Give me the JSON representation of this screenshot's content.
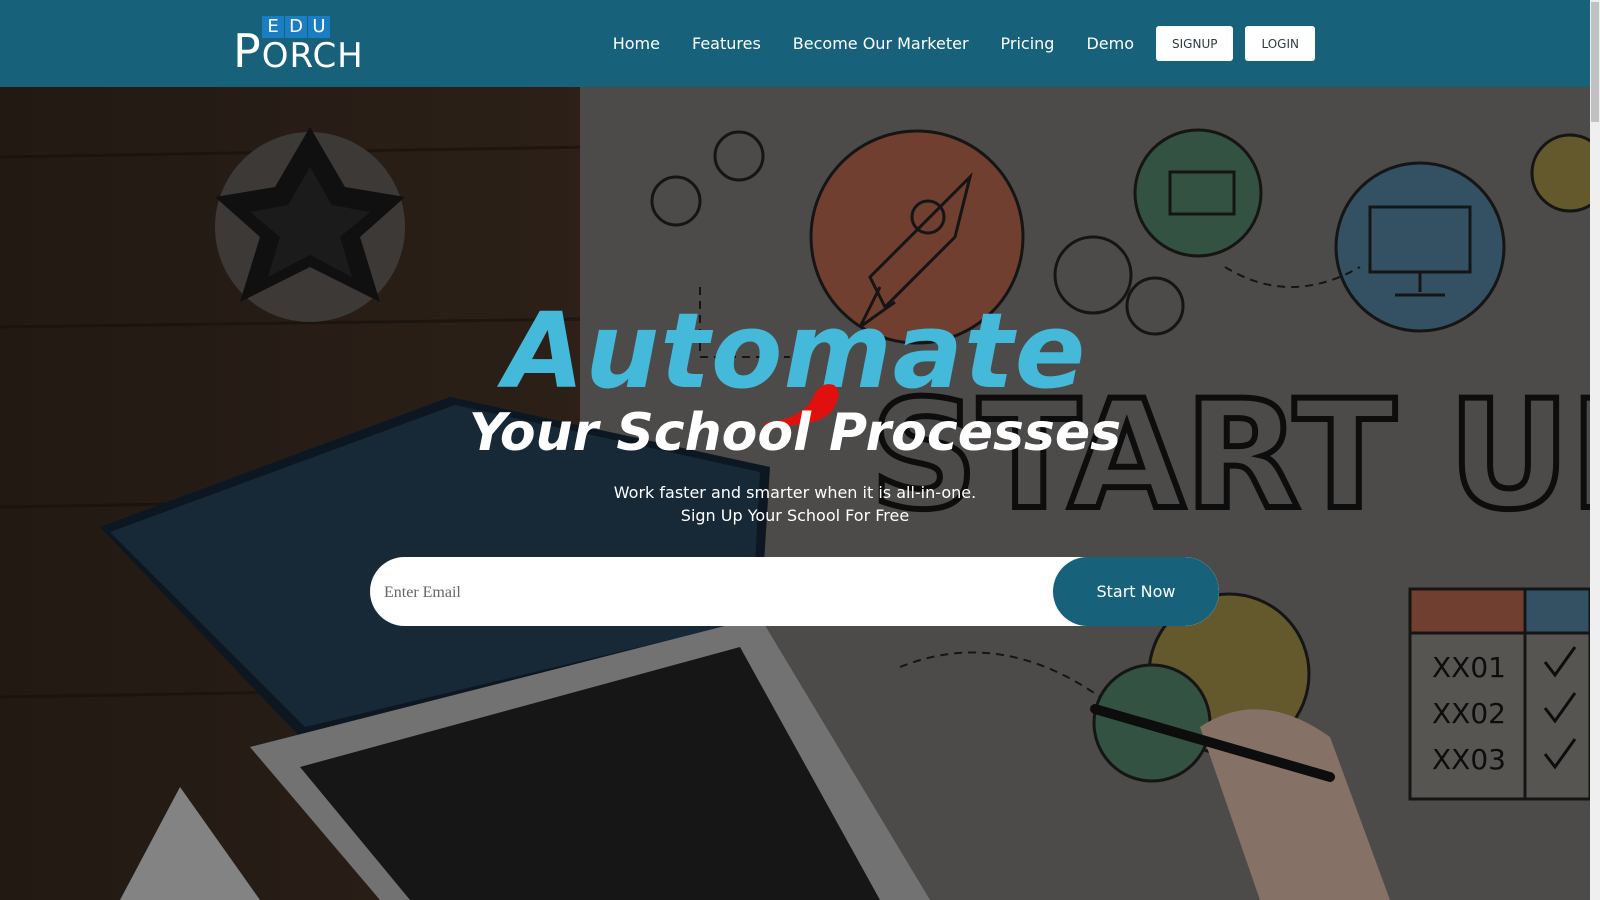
{
  "logo": {
    "edu_letters": [
      "E",
      "D",
      "U"
    ],
    "porch_initial": "P",
    "porch_rest": "ORCH"
  },
  "nav": {
    "items": [
      {
        "label": "Home"
      },
      {
        "label": "Features"
      },
      {
        "label": "Become Our Marketer"
      },
      {
        "label": "Pricing"
      },
      {
        "label": "Demo"
      }
    ],
    "signup_label": "SIGNUP",
    "login_label": "LOGIN"
  },
  "hero": {
    "headline_main": "Automate",
    "headline_sub": "Your School Processes",
    "subtitle_line1": "Work faster and smarter when it is all-in-one.",
    "subtitle_line2": "Sign Up Your School For Free",
    "email_placeholder": "Enter Email",
    "cta_label": "Start Now",
    "background_text": "START UP",
    "checklist": [
      "XX01",
      "XX02",
      "XX03"
    ]
  },
  "colors": {
    "header_bg": "#17617b",
    "headline_blue": "#44b9da",
    "logo_edu_blue": "#1c7ec2",
    "cta_bg": "#17617b"
  }
}
